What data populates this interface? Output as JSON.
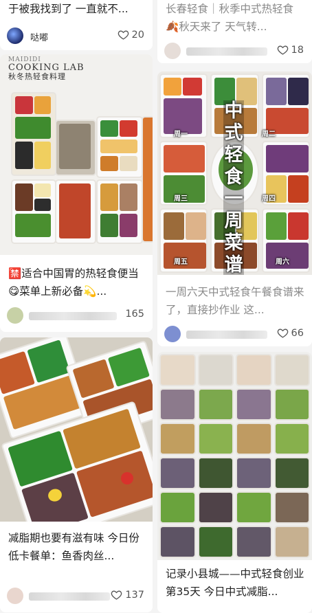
{
  "feed": {
    "cards": [
      {
        "title": "于被我找到了 一直就不...",
        "author": "哒嘟",
        "likes": "20"
      },
      {
        "title": "长春轻食｜秋季中式热轻食 🍂秋天来了 天气转...",
        "author": "",
        "likes": "18"
      },
      {
        "image_text": {
          "brand_line1": "MAIDIDI",
          "brand_line2": "COOKING LAB",
          "subtitle": "秋冬热轻食料理"
        },
        "title": "🈲适合中国胃的热轻食便当😋菜单上新必备💫...",
        "badge": "秘",
        "author": "",
        "likes": "165"
      },
      {
        "image_text": {
          "headline": "中式轻食一周菜谱",
          "day_labels": [
            "周一",
            "周二",
            "周三",
            "周四",
            "周五",
            "周六"
          ]
        },
        "title": "一周六天中式轻食午餐食谱来了，直接抄作业 这...",
        "author": "",
        "likes": "66"
      },
      {
        "title": "减脂期也要有滋有味 今日份低卡餐单：鱼香肉丝...",
        "author": "",
        "likes": "137"
      },
      {
        "title": "记录小县城——中式轻食创业第35天 今日中式减脂...",
        "author": "",
        "likes": ""
      }
    ]
  },
  "colors": {
    "background": "#f4f4f4",
    "card": "#ffffff",
    "title_text": "#222222",
    "muted_text": "#8a8a8a"
  }
}
